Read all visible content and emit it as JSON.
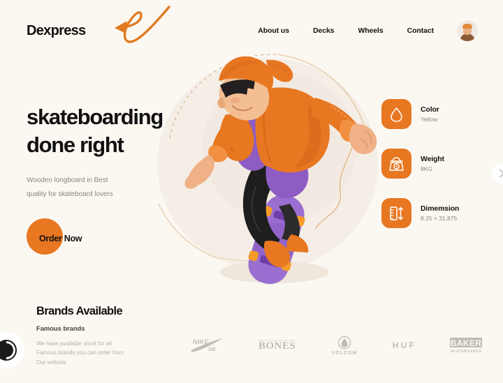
{
  "header": {
    "logo": "Dexpress",
    "nav": [
      {
        "label": "About us"
      },
      {
        "label": "Decks"
      },
      {
        "label": "Wheels"
      },
      {
        "label": "Contact"
      }
    ]
  },
  "hero": {
    "headline_line1": "skateboarding",
    "headline_line2": "done right",
    "sub_line1": "Wooden longboard in Best",
    "sub_line2": "quality for skateboard lovers",
    "cta_label": "Order Now"
  },
  "specs": [
    {
      "icon": "droplet-icon",
      "title": "Color",
      "value": "Yellow"
    },
    {
      "icon": "scale-icon",
      "title": "Weight",
      "value": "8KG"
    },
    {
      "icon": "ruler-icon",
      "title": "Dimemsion",
      "value": "8.25 × 31.875"
    }
  ],
  "brands": {
    "title": "Brands Available",
    "subtitle": "Famous brands",
    "body_line1": "We have available stock for all",
    "body_line2": "Famous brands you can order from",
    "body_line3": "Our website",
    "logos": [
      {
        "name": "NIKE SB"
      },
      {
        "name": "BONES"
      },
      {
        "name": "VOLCOM"
      },
      {
        "name": "HUF"
      },
      {
        "name": "BAKER"
      }
    ]
  },
  "controls": {
    "next_slide": "next-slide-chevron",
    "accessibility": "contrast-toggle"
  },
  "colors": {
    "background": "#FBF8F2",
    "accent_orange": "#E87722",
    "purple": "#8E5DC4",
    "ink": "#15120F",
    "muted": "#8B8682"
  }
}
